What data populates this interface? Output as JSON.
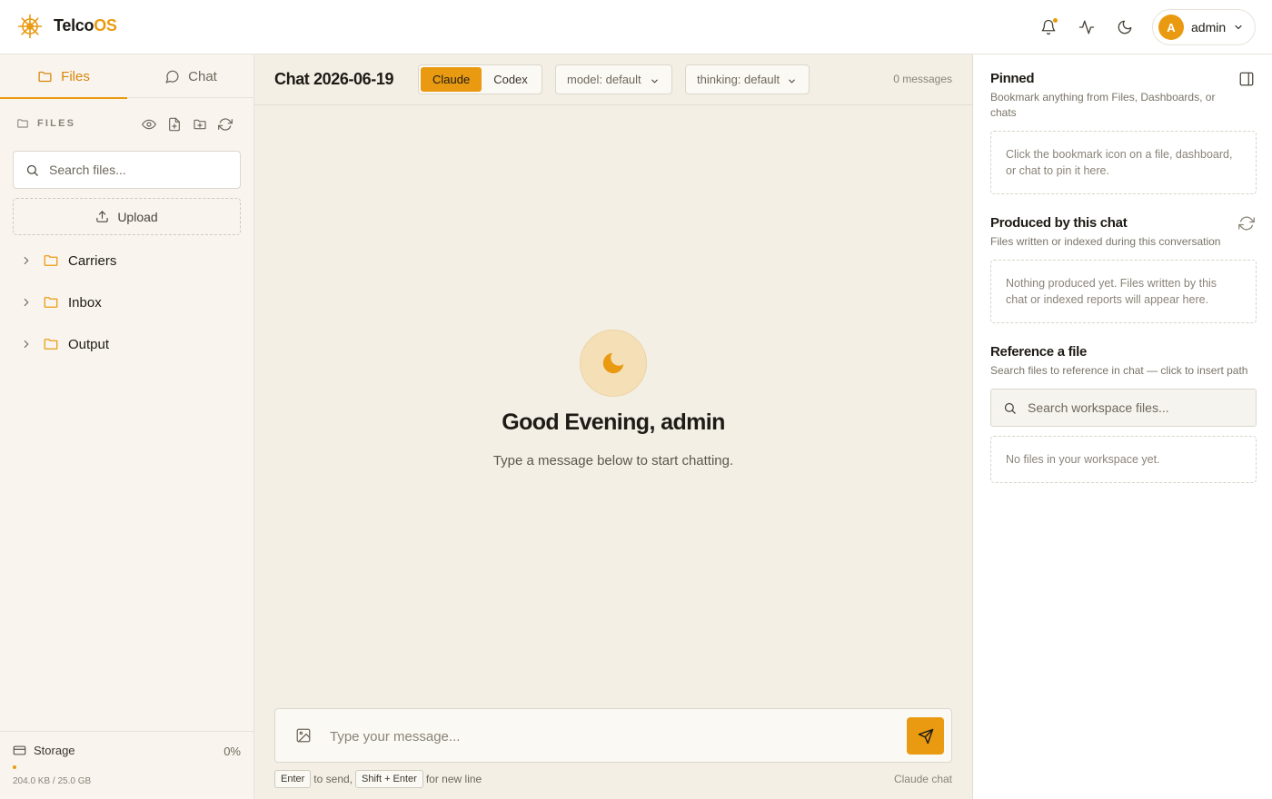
{
  "app": {
    "brand_part1": "Telco",
    "brand_part2": "OS",
    "accent_color": "#e99a10"
  },
  "header": {
    "icons": [
      "bell-icon",
      "activity-icon",
      "moon-icon"
    ],
    "user": {
      "initial": "A",
      "name": "admin"
    }
  },
  "sidebar": {
    "tabs": [
      {
        "label": "Files",
        "icon": "folder-icon",
        "active": true
      },
      {
        "label": "Chat",
        "icon": "message-icon",
        "active": false
      }
    ],
    "section_label": "FILES",
    "actions": [
      "eye-icon",
      "new-file-icon",
      "new-folder-icon",
      "refresh-icon"
    ],
    "search_placeholder": "Search files...",
    "upload_label": "Upload",
    "tree": [
      {
        "name": "Carriers"
      },
      {
        "name": "Inbox"
      },
      {
        "name": "Output"
      }
    ],
    "storage": {
      "label": "Storage",
      "percent": "0%",
      "used_fraction": 0.0,
      "size": "204.0 KB / 25.0 GB"
    }
  },
  "chat": {
    "title": "Chat 2026-06-19",
    "providers": [
      "Claude",
      "Codex"
    ],
    "active_provider": "Claude",
    "model_label": "model: default",
    "thinking_label": "thinking: default",
    "message_count": "0 messages",
    "greeting": "Good Evening, admin",
    "subgreeting": "Type a message below to start chatting.",
    "input_placeholder": "Type your message...",
    "hint_key1": "Enter",
    "hint_text1": "to send,",
    "hint_key2": "Shift + Enter",
    "hint_text2": "for new line",
    "footer_label": "Claude chat"
  },
  "right_panel": {
    "pinned": {
      "title": "Pinned",
      "description": "Bookmark anything from Files, Dashboards, or chats",
      "empty": "Click the bookmark icon on a file, dashboard, or chat to pin it here."
    },
    "produced": {
      "title": "Produced by this chat",
      "description": "Files written or indexed during this conversation",
      "empty": "Nothing produced yet. Files written by this chat or indexed reports will appear here."
    },
    "reference": {
      "title": "Reference a file",
      "description": "Search files to reference in chat — click to insert path",
      "search_placeholder": "Search workspace files...",
      "empty": "No files in your workspace yet."
    }
  }
}
